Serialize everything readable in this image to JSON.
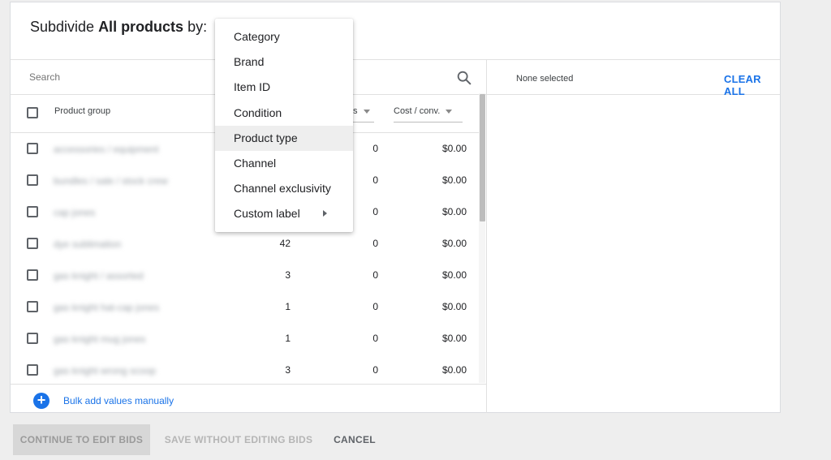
{
  "dialog": {
    "title_prefix": "Subdivide ",
    "title_bold": "All products",
    "title_suffix": " by:"
  },
  "search": {
    "placeholder": "Search",
    "icon": "search-icon"
  },
  "table": {
    "columns": [
      {
        "label": "Product group"
      },
      {
        "label": "s"
      },
      {
        "label": "Cost / conv."
      }
    ],
    "rows": [
      {
        "group": "accessories / equipment",
        "products": "",
        "conversions": "0",
        "cost_conv": "$0.00"
      },
      {
        "group": "bundles / sale / stock crew",
        "products": "",
        "conversions": "0",
        "cost_conv": "$0.00"
      },
      {
        "group": "cap jones",
        "products": "",
        "conversions": "0",
        "cost_conv": "$0.00"
      },
      {
        "group": "dye sublimation",
        "products": "42",
        "conversions": "0",
        "cost_conv": "$0.00"
      },
      {
        "group": "gas knight / assorted",
        "products": "3",
        "conversions": "0",
        "cost_conv": "$0.00"
      },
      {
        "group": "gas knight hat-cap jones",
        "products": "1",
        "conversions": "0",
        "cost_conv": "$0.00"
      },
      {
        "group": "gas knight mug jones",
        "products": "1",
        "conversions": "0",
        "cost_conv": "$0.00"
      },
      {
        "group": "gas knight wrong scoop",
        "products": "3",
        "conversions": "0",
        "cost_conv": "$0.00"
      }
    ]
  },
  "bulk_add": {
    "label": "Bulk add values manually"
  },
  "selection": {
    "none_selected": "None selected",
    "clear_all": "CLEAR ALL"
  },
  "footer": {
    "continue": "CONTINUE TO EDIT BIDS",
    "save": "SAVE WITHOUT EDITING BIDS",
    "cancel": "CANCEL"
  },
  "menu": {
    "items": [
      {
        "label": "Category"
      },
      {
        "label": "Brand"
      },
      {
        "label": "Item ID"
      },
      {
        "label": "Condition"
      },
      {
        "label": "Product type",
        "highlighted": true
      },
      {
        "label": "Channel"
      },
      {
        "label": "Channel exclusivity"
      },
      {
        "label": "Custom label",
        "has_submenu": true
      }
    ]
  }
}
